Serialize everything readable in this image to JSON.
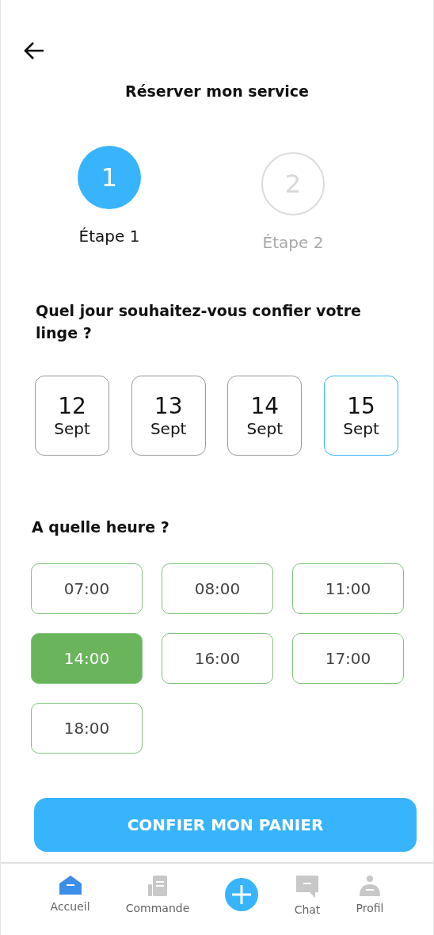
{
  "header": {
    "title": "Réserver mon service"
  },
  "steps": [
    {
      "number": "1",
      "label": "Étape 1",
      "selected": true
    },
    {
      "number": "2",
      "label": "Étape 2",
      "selected": false
    }
  ],
  "day_question": "Quel jour souhaitez-vous confier votre linge ?",
  "days": [
    {
      "day": "12",
      "month": "Sept",
      "selected": false
    },
    {
      "day": "13",
      "month": "Sept",
      "selected": false
    },
    {
      "day": "14",
      "month": "Sept",
      "selected": false
    },
    {
      "day": "15",
      "month": "Sept",
      "selected": true
    }
  ],
  "time_question": "A quelle heure ?",
  "times": [
    {
      "label": "07:00",
      "selected": false
    },
    {
      "label": "08:00",
      "selected": false
    },
    {
      "label": "11:00",
      "selected": false
    },
    {
      "label": "14:00",
      "selected": true
    },
    {
      "label": "16:00",
      "selected": false
    },
    {
      "label": "17:00",
      "selected": false
    },
    {
      "label": "18:00",
      "selected": false
    }
  ],
  "submit_button": "CONFIER MON PANIER",
  "nav": [
    {
      "kind": "home",
      "label": "Accueil",
      "selected": true
    },
    {
      "kind": "orders",
      "label": "Commande",
      "selected": false
    },
    {
      "kind": "add"
    },
    {
      "kind": "chat",
      "label": "Chat",
      "selected": false
    },
    {
      "kind": "profile",
      "label": "Profil",
      "selected": false
    }
  ]
}
